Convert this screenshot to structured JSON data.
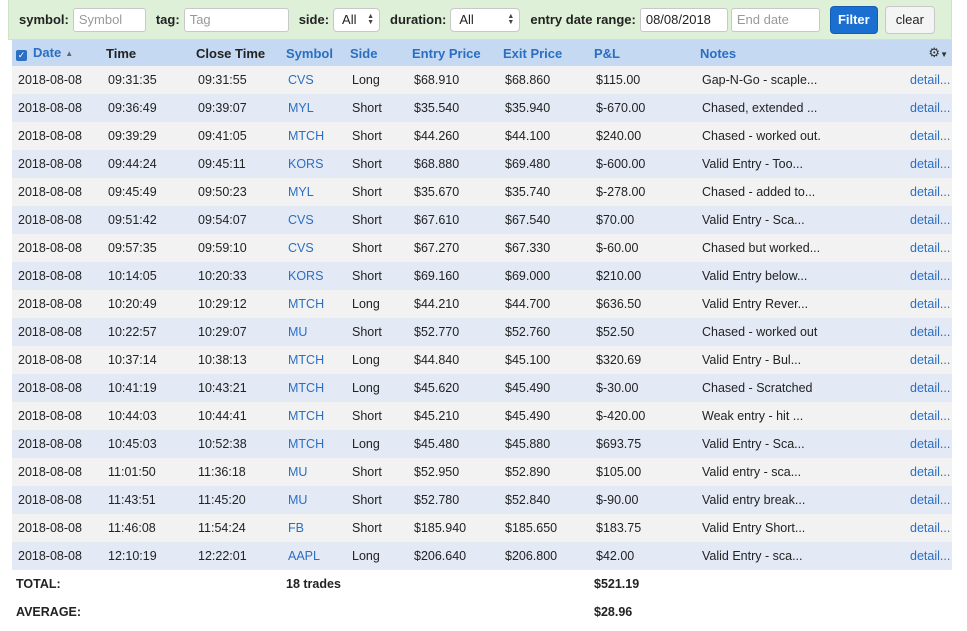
{
  "filters": {
    "symbol_label": "symbol:",
    "symbol_placeholder": "Symbol",
    "tag_label": "tag:",
    "tag_placeholder": "Tag",
    "side_label": "side:",
    "side_value": "All",
    "duration_label": "duration:",
    "duration_value": "All",
    "entry_date_label": "entry date range:",
    "start_date_value": "08/08/2018",
    "end_date_placeholder": "End date",
    "filter_button": "Filter",
    "clear_button": "clear"
  },
  "table": {
    "columns": {
      "date": "Date",
      "time": "Time",
      "close_time": "Close Time",
      "symbol": "Symbol",
      "side": "Side",
      "entry_price": "Entry Price",
      "exit_price": "Exit Price",
      "pnl": "P&L",
      "notes": "Notes"
    },
    "header_icons": {
      "select_all": "checkbox-checked-icon",
      "sort": "sort-ascending-icon",
      "settings": "gear-icon"
    },
    "colors": {
      "header_bg": "#c5d9f2",
      "link": "#2a6fc2",
      "row_odd": "#f2f2f2",
      "row_even": "#e4e9f6",
      "filter_bar_bg": "#dff0d8",
      "primary_button": "#1a6fd0"
    },
    "rows": [
      {
        "date": "2018-08-08",
        "time": "09:31:35",
        "close_time": "09:31:55",
        "symbol": "CVS",
        "side": "Long",
        "entry": "$68.910",
        "exit": "$68.860",
        "pnl": "$115.00",
        "notes": "Gap-N-Go - scaple...",
        "detail": "detail..."
      },
      {
        "date": "2018-08-08",
        "time": "09:36:49",
        "close_time": "09:39:07",
        "symbol": "MYL",
        "side": "Short",
        "entry": "$35.540",
        "exit": "$35.940",
        "pnl": "$-670.00",
        "notes": "Chased, extended ...",
        "detail": "detail..."
      },
      {
        "date": "2018-08-08",
        "time": "09:39:29",
        "close_time": "09:41:05",
        "symbol": "MTCH",
        "side": "Short",
        "entry": "$44.260",
        "exit": "$44.100",
        "pnl": "$240.00",
        "notes": "Chased - worked out.",
        "detail": "detail..."
      },
      {
        "date": "2018-08-08",
        "time": "09:44:24",
        "close_time": "09:45:11",
        "symbol": "KORS",
        "side": "Short",
        "entry": "$68.880",
        "exit": "$69.480",
        "pnl": "$-600.00",
        "notes": "Valid Entry - Too...",
        "detail": "detail..."
      },
      {
        "date": "2018-08-08",
        "time": "09:45:49",
        "close_time": "09:50:23",
        "symbol": "MYL",
        "side": "Short",
        "entry": "$35.670",
        "exit": "$35.740",
        "pnl": "$-278.00",
        "notes": "Chased - added to...",
        "detail": "detail..."
      },
      {
        "date": "2018-08-08",
        "time": "09:51:42",
        "close_time": "09:54:07",
        "symbol": "CVS",
        "side": "Short",
        "entry": "$67.610",
        "exit": "$67.540",
        "pnl": "$70.00",
        "notes": "Valid Entry - Sca...",
        "detail": "detail..."
      },
      {
        "date": "2018-08-08",
        "time": "09:57:35",
        "close_time": "09:59:10",
        "symbol": "CVS",
        "side": "Short",
        "entry": "$67.270",
        "exit": "$67.330",
        "pnl": "$-60.00",
        "notes": "Chased but worked...",
        "detail": "detail..."
      },
      {
        "date": "2018-08-08",
        "time": "10:14:05",
        "close_time": "10:20:33",
        "symbol": "KORS",
        "side": "Short",
        "entry": "$69.160",
        "exit": "$69.000",
        "pnl": "$210.00",
        "notes": "Valid Entry below...",
        "detail": "detail..."
      },
      {
        "date": "2018-08-08",
        "time": "10:20:49",
        "close_time": "10:29:12",
        "symbol": "MTCH",
        "side": "Long",
        "entry": "$44.210",
        "exit": "$44.700",
        "pnl": "$636.50",
        "notes": "Valid Entry Rever...",
        "detail": "detail..."
      },
      {
        "date": "2018-08-08",
        "time": "10:22:57",
        "close_time": "10:29:07",
        "symbol": "MU",
        "side": "Short",
        "entry": "$52.770",
        "exit": "$52.760",
        "pnl": "$52.50",
        "notes": "Chased - worked out",
        "detail": "detail..."
      },
      {
        "date": "2018-08-08",
        "time": "10:37:14",
        "close_time": "10:38:13",
        "symbol": "MTCH",
        "side": "Long",
        "entry": "$44.840",
        "exit": "$45.100",
        "pnl": "$320.69",
        "notes": "Valid Entry - Bul...",
        "detail": "detail..."
      },
      {
        "date": "2018-08-08",
        "time": "10:41:19",
        "close_time": "10:43:21",
        "symbol": "MTCH",
        "side": "Long",
        "entry": "$45.620",
        "exit": "$45.490",
        "pnl": "$-30.00",
        "notes": "Chased - Scratched",
        "detail": "detail..."
      },
      {
        "date": "2018-08-08",
        "time": "10:44:03",
        "close_time": "10:44:41",
        "symbol": "MTCH",
        "side": "Short",
        "entry": "$45.210",
        "exit": "$45.490",
        "pnl": "$-420.00",
        "notes": "Weak entry - hit ...",
        "detail": "detail..."
      },
      {
        "date": "2018-08-08",
        "time": "10:45:03",
        "close_time": "10:52:38",
        "symbol": "MTCH",
        "side": "Long",
        "entry": "$45.480",
        "exit": "$45.880",
        "pnl": "$693.75",
        "notes": "Valid Entry - Sca...",
        "detail": "detail..."
      },
      {
        "date": "2018-08-08",
        "time": "11:01:50",
        "close_time": "11:36:18",
        "symbol": "MU",
        "side": "Short",
        "entry": "$52.950",
        "exit": "$52.890",
        "pnl": "$105.00",
        "notes": "Valid entry - sca...",
        "detail": "detail..."
      },
      {
        "date": "2018-08-08",
        "time": "11:43:51",
        "close_time": "11:45:20",
        "symbol": "MU",
        "side": "Short",
        "entry": "$52.780",
        "exit": "$52.840",
        "pnl": "$-90.00",
        "notes": "Valid entry break...",
        "detail": "detail..."
      },
      {
        "date": "2018-08-08",
        "time": "11:46:08",
        "close_time": "11:54:24",
        "symbol": "FB",
        "side": "Short",
        "entry": "$185.940",
        "exit": "$185.650",
        "pnl": "$183.75",
        "notes": "Valid Entry Short...",
        "detail": "detail..."
      },
      {
        "date": "2018-08-08",
        "time": "12:10:19",
        "close_time": "12:22:01",
        "symbol": "AAPL",
        "side": "Long",
        "entry": "$206.640",
        "exit": "$206.800",
        "pnl": "$42.00",
        "notes": "Valid Entry - sca...",
        "detail": "detail..."
      }
    ],
    "summary": {
      "total_label": "TOTAL:",
      "trade_count": "18 trades",
      "total_pnl": "$521.19",
      "average_label": "AVERAGE:",
      "average_pnl": "$28.96"
    }
  }
}
